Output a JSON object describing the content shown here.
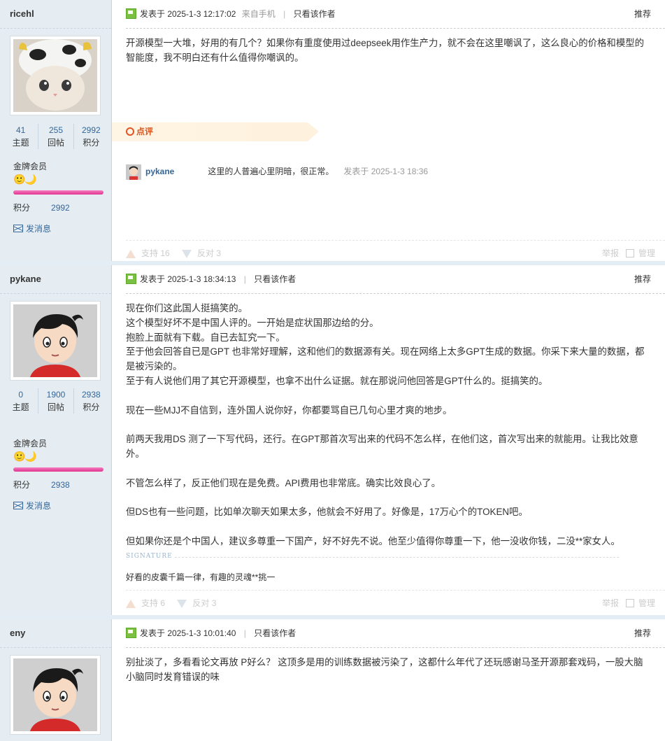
{
  "posts": [
    {
      "username": "ricehl",
      "stats": [
        {
          "num": "41",
          "label": "主题"
        },
        {
          "num": "255",
          "label": "回帖"
        },
        {
          "num": "2992",
          "label": "积分"
        }
      ],
      "rank": "金牌会员",
      "medals": "🙂🌙",
      "points_label": "积分",
      "points": "2992",
      "msg_label": "发消息",
      "posted": "发表于 2025-1-3 12:17:02",
      "from": "来自手机",
      "only_author": "只看该作者",
      "recommend": "推荐",
      "content": "开源模型一大堆，好用的有几个？如果你有重度使用过deepseek用作生产力，就不会在这里嘲讽了，这么良心的价格和模型的智能度，我不明白还有什么值得你嘲讽的。",
      "comment_header": "点评",
      "comment": {
        "user": "pykane",
        "text": "这里的人普遍心里阴暗，很正常。",
        "date": "发表于 2025-1-3 18:36"
      },
      "support": "支持 16",
      "oppose": "反对 3",
      "report": "举报",
      "manage": "管理"
    },
    {
      "username": "pykane",
      "stats": [
        {
          "num": "0",
          "label": "主题"
        },
        {
          "num": "1900",
          "label": "回帖"
        },
        {
          "num": "2938",
          "label": "积分"
        }
      ],
      "rank": "金牌会员",
      "medals": "🙂🌙",
      "points_label": "积分",
      "points": "2938",
      "msg_label": "发消息",
      "posted": "发表于 2025-1-3 18:34:13",
      "only_author": "只看该作者",
      "recommend": "推荐",
      "content": "现在你们这此国人挺搞笑的。\n这个模型好坏不是中国人评的。一开始是症状国那边给的分。\n抱脸上面就有下载。自已去缸究一下。\n至于他会回答自已是GPT 也非常好理解，这和他们的数据源有关。现在网络上太多GPT生成的数据。你采下来大量的数据，都是被污染的。\n至于有人说他们用了其它开源模型，也拿不出什么证据。就在那说问他回答是GPT什么的。挺搞笑的。\n\n现在一些MJJ不自信到，连外国人说你好，你都要骂自已几句心里才爽的地步。\n\n前两天我用DS 测了一下写代码，还行。在GPT那首次写出来的代码不怎么样，在他们这，首次写出来的就能用。让我比效意外。\n\n不管怎么样了，反正他们现在是免费。API费用也非常底。确实比效良心了。\n\n但DS也有一些问题，比如单次聊天如果太多，他就会不好用了。好像是，17万心个的TOKEN吧。\n\n但如果你还是个中国人，建议多尊重一下国产，好不好先不说。他至少值得你尊重一下，他一没收你钱，二没**家女人。",
      "signature_label": "SIGNATURE",
      "signature": "好看的皮囊千篇一律，有趣的灵魂**挑一",
      "support": "支持 6",
      "oppose": "反对 3",
      "report": "举报",
      "manage": "管理"
    },
    {
      "username": "eny",
      "posted": "发表于 2025-1-3 10:01:40",
      "only_author": "只看该作者",
      "recommend": "推荐",
      "content": "别扯淡了，多看看论文再放 P好么？ 这顶多是用的训练数据被污染了，这都什么年代了还玩感谢马圣开源那套戏码，一股大脑小脑同时发育错误的味"
    }
  ]
}
